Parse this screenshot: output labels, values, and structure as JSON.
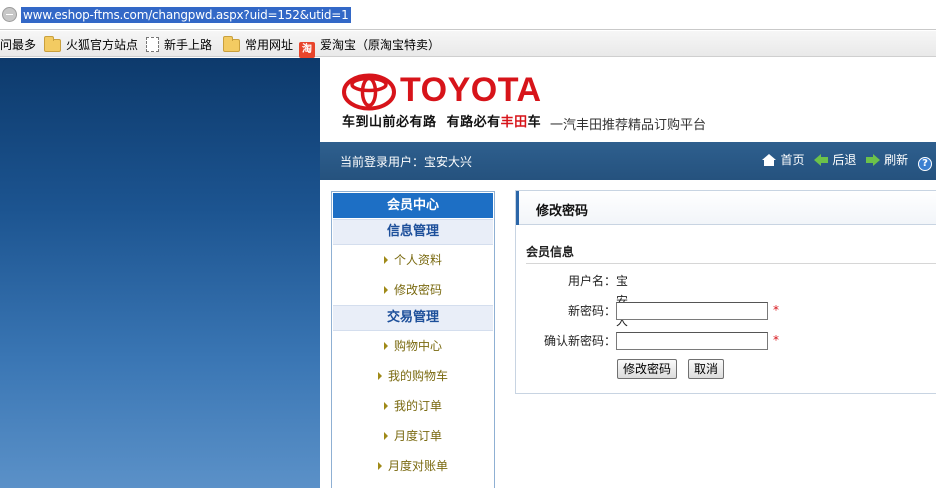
{
  "browser": {
    "url": "www.eshop-ftms.com/changpwd.aspx?uid=152&utid=1"
  },
  "bookmarks": {
    "items": [
      {
        "label": "问最多",
        "icon": "none"
      },
      {
        "label": "火狐官方站点",
        "icon": "folder-icon"
      },
      {
        "label": "新手上路",
        "icon": "page-icon"
      },
      {
        "label": "常用网址",
        "icon": "folder-icon"
      },
      {
        "label": "爱淘宝（原淘宝特卖）",
        "icon": "taobao-icon",
        "icon_glyph": "淘"
      }
    ]
  },
  "header": {
    "brand": "TOYOTA",
    "slogan_part1": "车到山前必有路",
    "slogan_part2": "有路必有",
    "slogan_highlight": "丰田",
    "slogan_part3": "车",
    "platform": "一汽丰田推荐精品订购平台",
    "brand_color": "#d7141a"
  },
  "navbar": {
    "current_user": "当前登录用户：宝安大兴",
    "links": [
      {
        "label": "首页",
        "icon": "home-icon"
      },
      {
        "label": "后退",
        "icon": "arrow-left-icon"
      },
      {
        "label": "刷新",
        "icon": "arrow-right-icon"
      }
    ],
    "help_glyph": "?"
  },
  "sidebar": {
    "title": "会员中心",
    "groups": [
      {
        "label": "信息管理",
        "items": [
          "个人资料",
          "修改密码"
        ]
      },
      {
        "label": "交易管理",
        "items": [
          "购物中心",
          "我的购物车",
          "我的订单",
          "月度订单",
          "月度对账单"
        ]
      }
    ]
  },
  "form": {
    "title": "修改密码",
    "section": "会员信息",
    "username_label": "用户名：",
    "username_value": "宝安大兴",
    "new_password_label": "新密码：",
    "confirm_password_label": "确认新密码：",
    "new_password_value": "",
    "confirm_password_value": "",
    "required_mark": "*",
    "submit_label": "修改密码",
    "cancel_label": "取消"
  }
}
